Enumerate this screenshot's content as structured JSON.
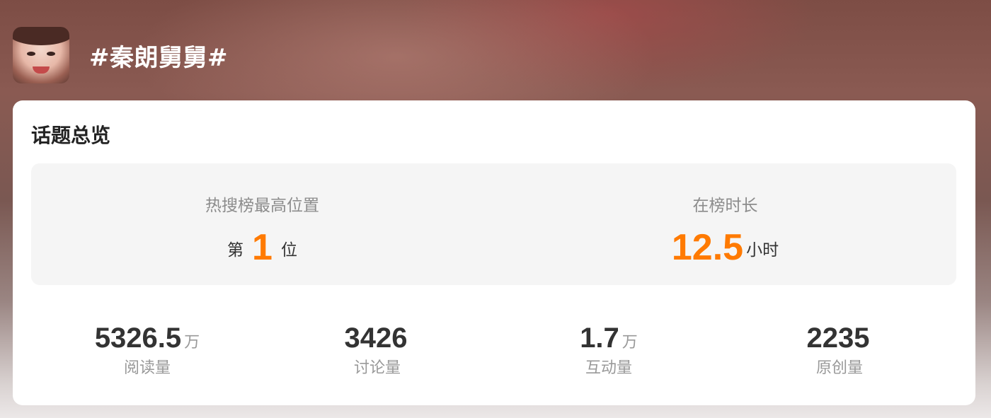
{
  "header": {
    "topic_title": "#秦朗舅舅#"
  },
  "overview": {
    "title": "话题总览",
    "hot_search": {
      "label": "热搜榜最高位置",
      "prefix": "第",
      "value": "1",
      "suffix": "位"
    },
    "duration": {
      "label": "在榜时长",
      "value": "12.5",
      "unit": "小时"
    },
    "stats": [
      {
        "value": "5326.5",
        "unit": "万",
        "label": "阅读量"
      },
      {
        "value": "3426",
        "unit": "",
        "label": "讨论量"
      },
      {
        "value": "1.7",
        "unit": "万",
        "label": "互动量"
      },
      {
        "value": "2235",
        "unit": "",
        "label": "原创量"
      }
    ]
  },
  "colors": {
    "accent": "#ff7a00",
    "card_bg": "#ffffff",
    "summary_bg": "#f5f5f5"
  },
  "icons": {
    "avatar": "topic-avatar-photo"
  }
}
